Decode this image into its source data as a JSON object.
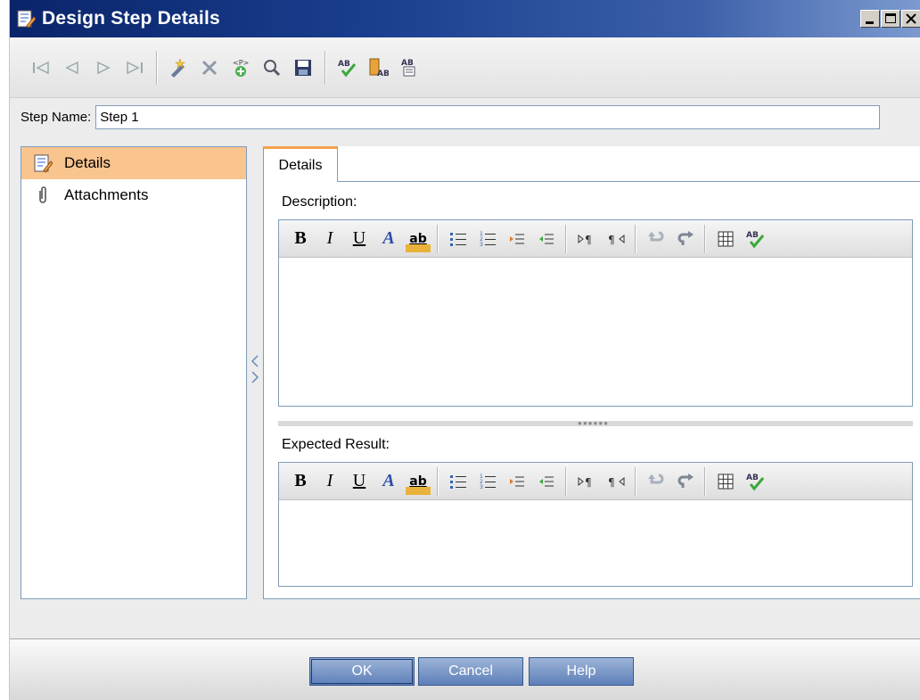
{
  "window": {
    "title": "Design Step Details"
  },
  "step_name": {
    "label": "Step Name:",
    "value": "Step 1"
  },
  "nav": {
    "items": [
      {
        "label": "Details",
        "icon": "details-icon",
        "selected": true
      },
      {
        "label": "Attachments",
        "icon": "paperclip-icon",
        "selected": false
      }
    ]
  },
  "tabs": [
    {
      "label": "Details",
      "active": true
    }
  ],
  "fields": {
    "description_label": "Description:",
    "expected_result_label": "Expected Result:"
  },
  "editor_toolbar": {
    "bold": "B",
    "italic": "I",
    "underline": "U",
    "font_color": "A",
    "highlight": "ab"
  },
  "buttons": {
    "ok": "OK",
    "cancel": "Cancel",
    "help": "Help"
  },
  "colors": {
    "title_bar": "#0a246a",
    "nav_selected": "#f9c48e",
    "tab_accent": "#f4a24c",
    "dialog_button": "#5d7fb8"
  }
}
